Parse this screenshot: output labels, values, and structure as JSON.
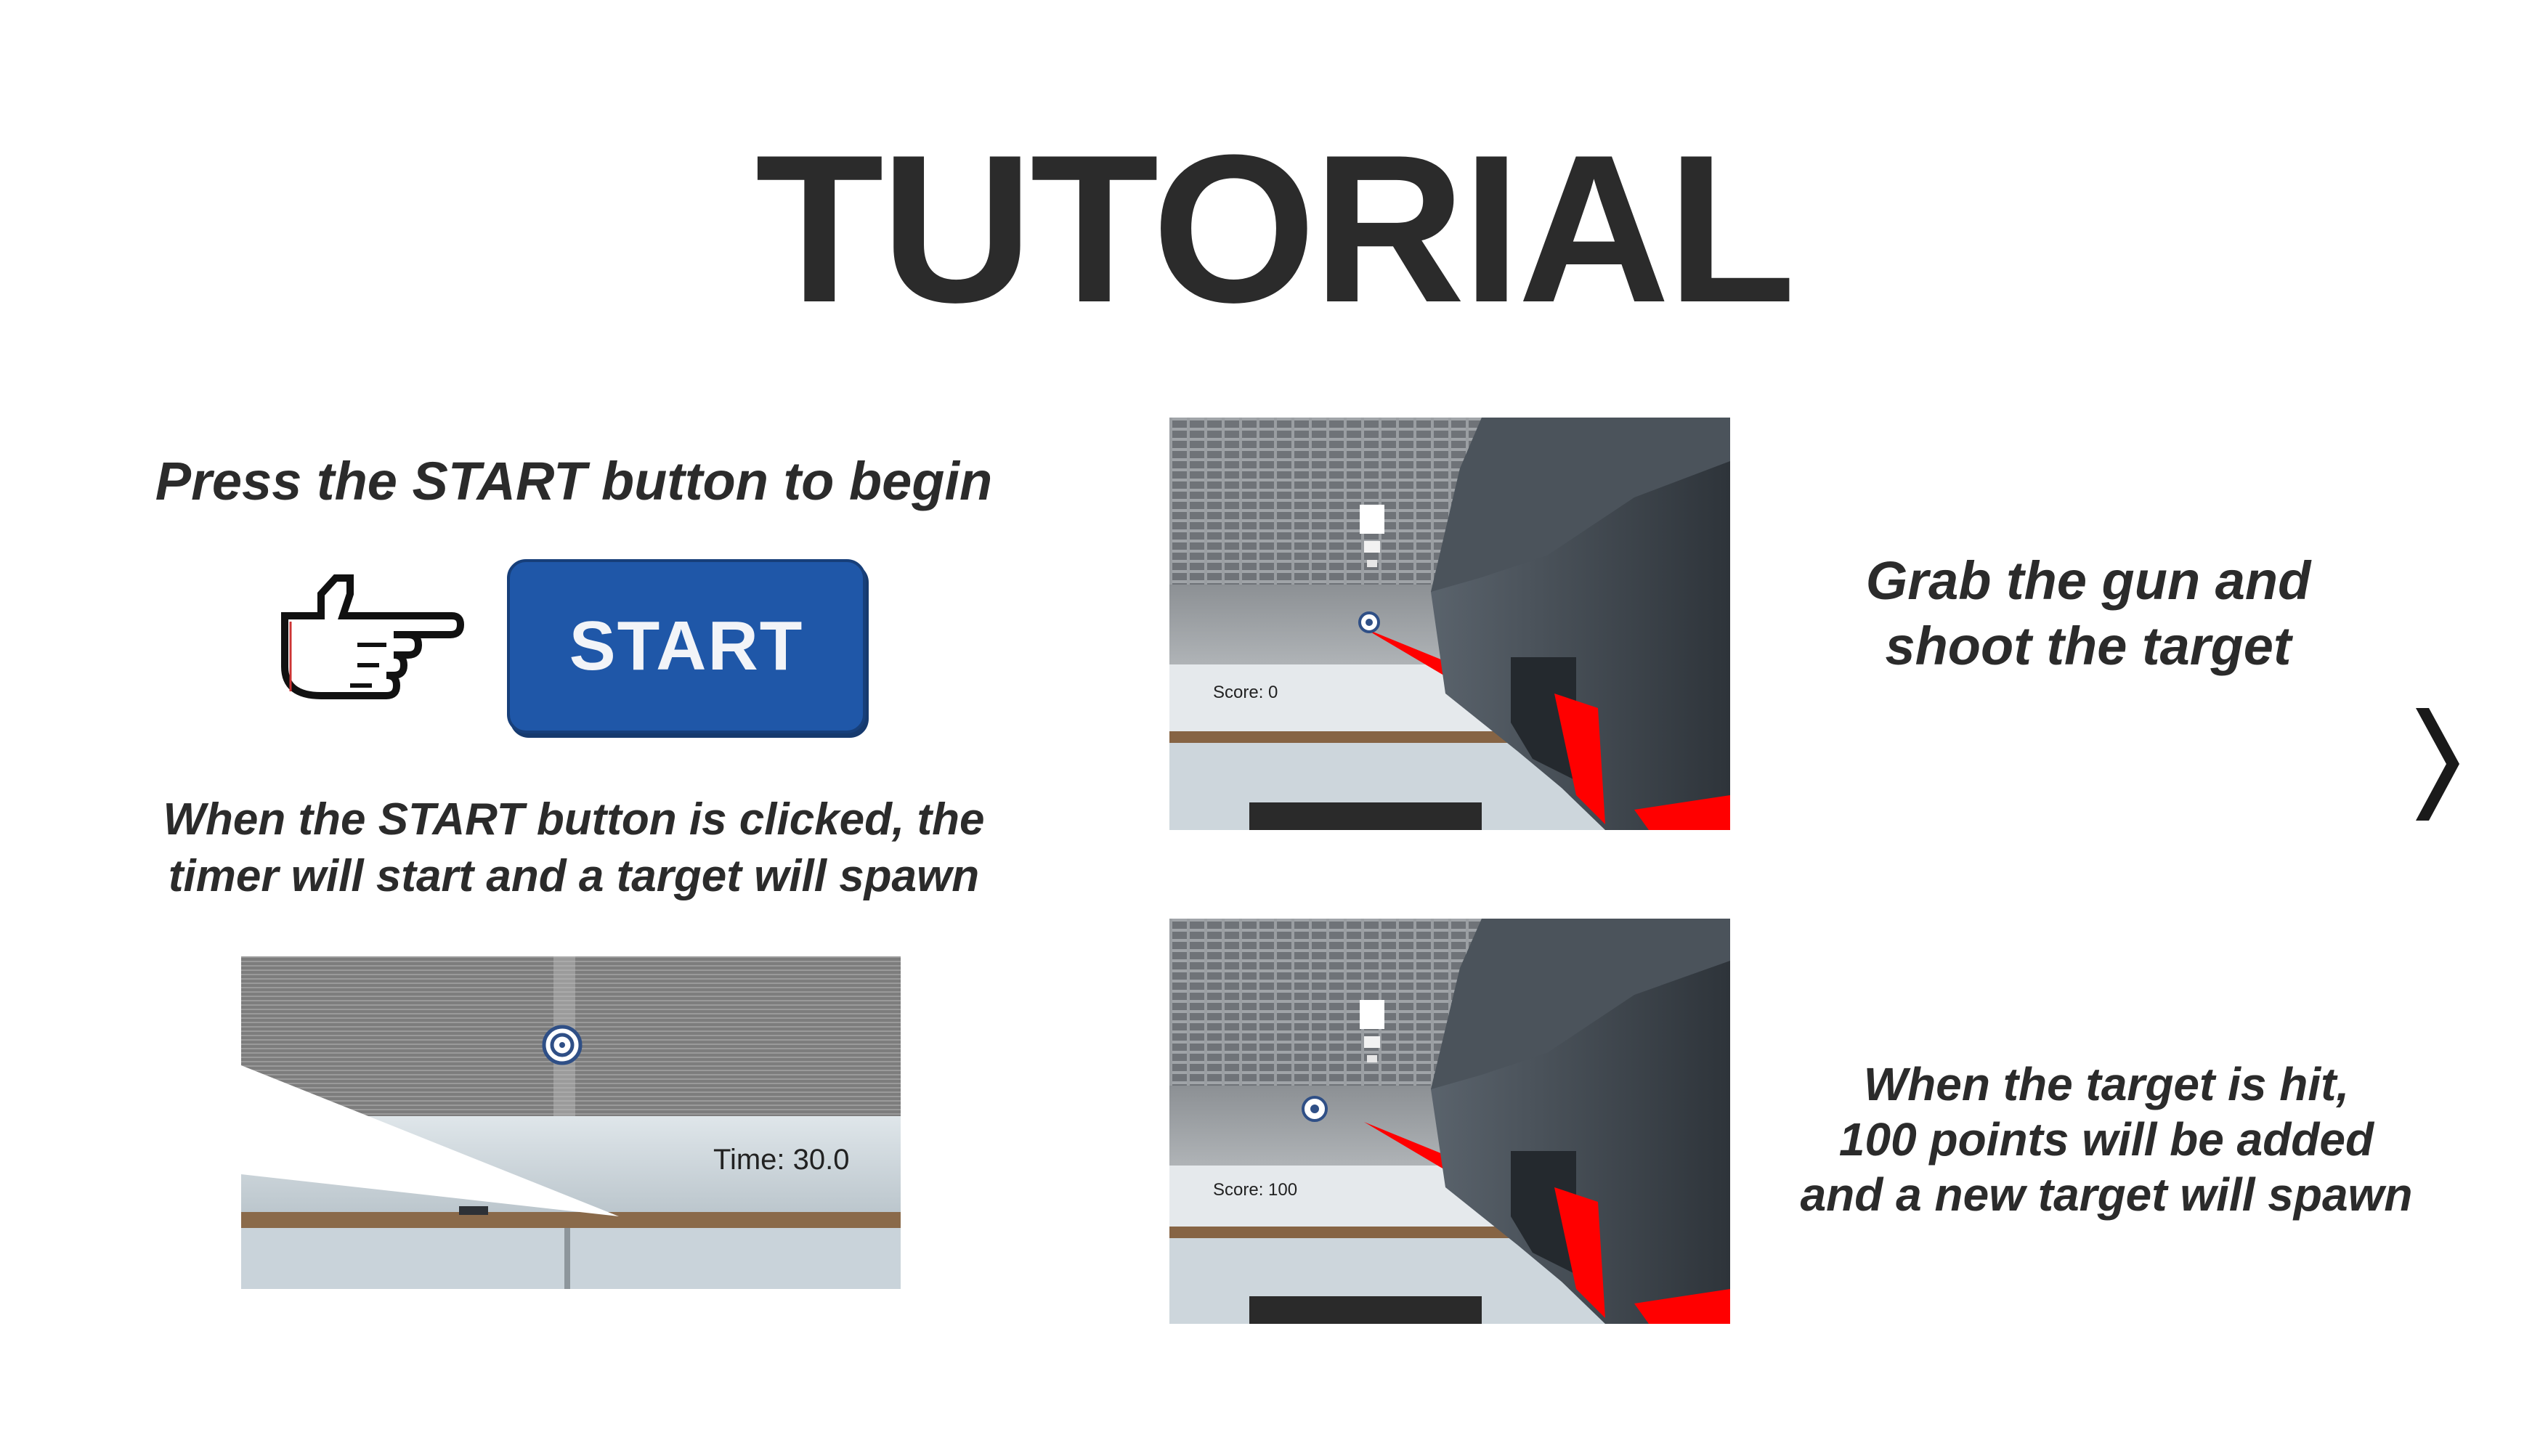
{
  "page": {
    "title": "TUTORIAL",
    "caption_start": "Press the START button to begin",
    "caption_timer": [
      "When the START button is clicked, the",
      "timer will start and a target will spawn"
    ],
    "caption_grab": [
      "Grab the gun and",
      "shoot the target"
    ],
    "caption_hit": [
      "When the target is hit,",
      "100 points will be added",
      "and a new target will spawn"
    ]
  },
  "start_button": {
    "label": "START"
  },
  "screenshots": {
    "score_before": "Score: 0",
    "score_after": "Score: 100",
    "timer": "Time: 30.0"
  },
  "icons": {
    "pointer": "pointing-hand-icon",
    "next": "chevron-right-icon"
  },
  "colors": {
    "text": "#2b2b2b",
    "button": "#1f57a8",
    "laser": "#ff0000",
    "gun": "#3d444c"
  }
}
